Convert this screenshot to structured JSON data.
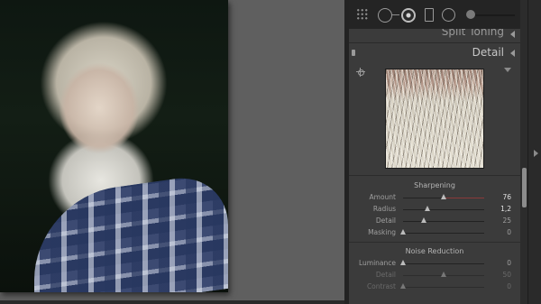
{
  "panels": {
    "split_toning": {
      "title": "Split Toning"
    },
    "detail": {
      "title": "Detail",
      "sharpening": {
        "title": "Sharpening",
        "rows": [
          {
            "label": "Amount",
            "value": "76",
            "fraction": 0.5
          },
          {
            "label": "Radius",
            "value": "1,2",
            "fraction": 0.3
          },
          {
            "label": "Detail",
            "value": "25",
            "fraction": 0.26
          },
          {
            "label": "Masking",
            "value": "0",
            "fraction": 0.0
          }
        ]
      },
      "noise_reduction": {
        "title": "Noise Reduction",
        "rows": [
          {
            "label": "Luminance",
            "value": "0",
            "fraction": 0.0
          },
          {
            "label": "Detail",
            "value": "50",
            "fraction": 0.5
          },
          {
            "label": "Contrast",
            "value": "0",
            "fraction": 0.0
          }
        ]
      }
    }
  },
  "icons": [
    "grid-tool-icon",
    "crop-circle-icon",
    "target-icon",
    "rectangle-tool-icon",
    "ring-tool-icon",
    "collapse-triangle-icon",
    "crosshair-icon",
    "preview-menu-icon",
    "panel-switch-icon",
    "expand-panel-icon"
  ],
  "colors": {
    "panel_bg": "#3b3b3b",
    "canvas_bg": "#5f5f5f",
    "toolstrip_bg": "#242424",
    "amount_track": "#8a3a3a"
  }
}
